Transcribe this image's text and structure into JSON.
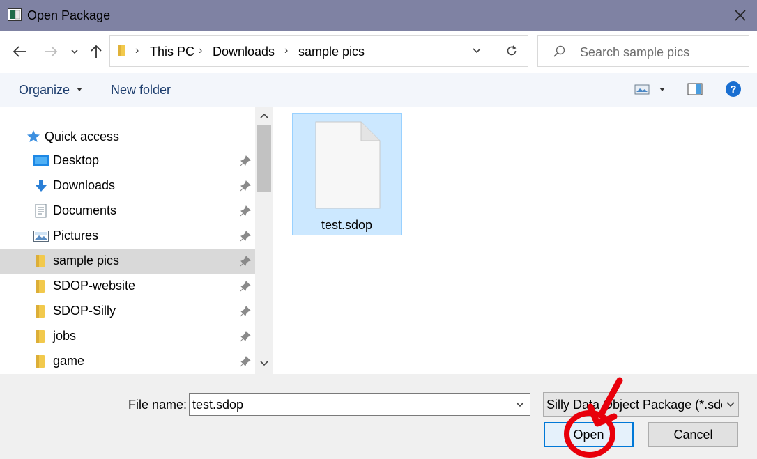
{
  "window": {
    "title": "Open Package",
    "close_icon": "close-icon"
  },
  "nav": {
    "back_icon": "arrow-left-icon",
    "forward_icon": "arrow-right-icon",
    "recent_icon": "chevron-down-icon",
    "up_icon": "arrow-up-icon",
    "breadcrumb": [
      "This PC",
      "Downloads",
      "sample pics"
    ],
    "refresh_icon": "refresh-icon"
  },
  "search": {
    "placeholder": "Search sample pics",
    "icon": "search-icon"
  },
  "toolbar": {
    "organize_label": "Organize",
    "new_folder_label": "New folder",
    "view_icon": "view-options-icon",
    "preview_pane_icon": "preview-pane-icon",
    "help_icon": "help-icon"
  },
  "sidebar": {
    "quick_access_label": "Quick access",
    "items": [
      {
        "label": "Desktop",
        "icon": "desktop-icon",
        "pinned": true
      },
      {
        "label": "Downloads",
        "icon": "downloads-icon",
        "pinned": true
      },
      {
        "label": "Documents",
        "icon": "documents-icon",
        "pinned": true
      },
      {
        "label": "Pictures",
        "icon": "pictures-icon",
        "pinned": true
      },
      {
        "label": "sample pics",
        "icon": "folder-icon",
        "pinned": true,
        "selected": true
      },
      {
        "label": "SDOP-website",
        "icon": "folder-icon",
        "pinned": true
      },
      {
        "label": "SDOP-Silly",
        "icon": "folder-icon",
        "pinned": true
      },
      {
        "label": "jobs",
        "icon": "folder-icon",
        "pinned": true
      },
      {
        "label": "game",
        "icon": "folder-icon",
        "pinned": true
      }
    ]
  },
  "files": [
    {
      "name": "test.sdop",
      "icon": "document-icon",
      "selected": true
    }
  ],
  "footer": {
    "file_name_label": "File name:",
    "file_name_value": "test.sdop",
    "file_type_value": "Silly Data Object Package (*.sdop)",
    "open_label": "Open",
    "cancel_label": "Cancel"
  },
  "colors": {
    "titlebar": "#7f82a3",
    "accent": "#0078d7",
    "selection": "#cce8ff",
    "annotation": "#e8000b"
  }
}
